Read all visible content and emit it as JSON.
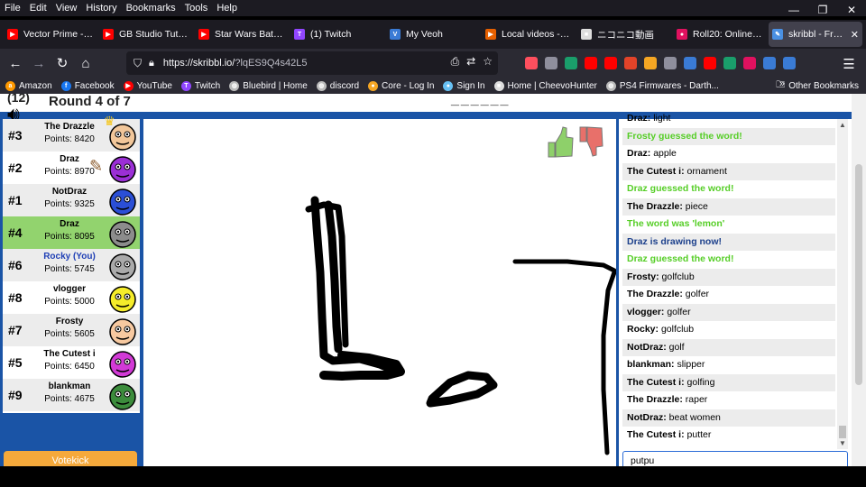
{
  "menubar": [
    "File",
    "Edit",
    "View",
    "History",
    "Bookmarks",
    "Tools",
    "Help"
  ],
  "window_controls": [
    "—",
    "❐",
    "✕"
  ],
  "tabs": [
    {
      "title": "Vector Prime - Pa",
      "icon": "youtube-icon",
      "color": "#ff0000",
      "glyph": "▶"
    },
    {
      "title": "GB Studio Tutorial",
      "icon": "youtube-icon",
      "color": "#ff0000",
      "glyph": "▶"
    },
    {
      "title": "Star Wars Battlefro",
      "icon": "youtube-icon",
      "color": "#ff0000",
      "glyph": "▶"
    },
    {
      "title": "(1) Twitch",
      "icon": "twitch-icon",
      "color": "#9146ff",
      "glyph": "T"
    },
    {
      "title": "My Veoh",
      "icon": "veoh-icon",
      "color": "#3a7bd5",
      "glyph": "V"
    },
    {
      "title": "Local videos - Ha",
      "icon": "play-icon",
      "color": "#e66000",
      "glyph": "▶"
    },
    {
      "title": "ニコニコ動画",
      "icon": "niconico-icon",
      "color": "#dddddd",
      "glyph": "■"
    },
    {
      "title": "Roll20: Online virt",
      "icon": "roll20-icon",
      "color": "#e0115f",
      "glyph": "●"
    },
    {
      "title": "skribbl - Free M",
      "icon": "skribbl-icon",
      "color": "#4a90e2",
      "glyph": "✎",
      "active": true
    }
  ],
  "nav": {
    "back": "←",
    "forward": "→",
    "reload": "↻",
    "home": "⌂",
    "url_host": "https://skribbl.io/",
    "url_path": "?lqES9Q4s42L5"
  },
  "extension_colors": [
    "#ff4f5e",
    "#8f8f9d",
    "#1a9e6b",
    "#ff0000",
    "#ff0000",
    "#e24329",
    "#f5a623",
    "#8f8f9d",
    "#3a7bd5",
    "#ff0000",
    "#1a9e6b",
    "#e0115f",
    "#3a7bd5",
    "#3a7bd5"
  ],
  "bookmarks": [
    {
      "label": "Amazon",
      "icon": "amazon-icon",
      "color": "#ff9900",
      "glyph": "a"
    },
    {
      "label": "Facebook",
      "icon": "facebook-icon",
      "color": "#1877f2",
      "glyph": "f"
    },
    {
      "label": "YouTube",
      "icon": "youtube-icon",
      "color": "#ff0000",
      "glyph": "▶"
    },
    {
      "label": "Twitch",
      "icon": "twitch-icon",
      "color": "#9146ff",
      "glyph": "T"
    },
    {
      "label": "Bluebird | Home",
      "icon": "globe-icon",
      "color": "#bbbbbb",
      "glyph": "◍"
    },
    {
      "label": "discord",
      "icon": "globe-icon",
      "color": "#bbbbbb",
      "glyph": "◍"
    },
    {
      "label": "Core - Log In",
      "icon": "core-icon",
      "color": "#f5a623",
      "glyph": "●"
    },
    {
      "label": "Sign In",
      "icon": "steam-icon",
      "color": "#66c0f4",
      "glyph": "●"
    },
    {
      "label": "Home | CheevoHunter",
      "icon": "page-icon",
      "color": "#dddddd",
      "glyph": "■"
    },
    {
      "label": "PS4 Firmwares - Darth...",
      "icon": "globe-icon",
      "color": "#bbbbbb",
      "glyph": "◍"
    }
  ],
  "other_bookmarks": "Other Bookmarks",
  "game": {
    "round_label": "Round 4 of 7",
    "timer": "(12)",
    "word_hint": "______",
    "votekick": "Votekick",
    "chat_input_value": "putpu",
    "players": [
      {
        "rank": "#3",
        "name": "The Drazzle",
        "points": "Points: 8420",
        "avatar_color": "#f2c79a",
        "crown": true,
        "style": "alt"
      },
      {
        "rank": "#2",
        "name": "Draz",
        "points": "Points: 8970",
        "avatar_color": "#9b2fd6",
        "pencil": true,
        "style": ""
      },
      {
        "rank": "#1",
        "name": "NotDraz",
        "points": "Points: 9325",
        "avatar_color": "#2b4fd6",
        "style": "alt"
      },
      {
        "rank": "#4",
        "name": "Draz",
        "points": "Points: 8095",
        "avatar_color": "#8c8c8c",
        "style": "drawer"
      },
      {
        "rank": "#6",
        "name": "Rocky (You)",
        "points": "Points: 5745",
        "avatar_color": "#aaaaaa",
        "you": true,
        "style": "alt"
      },
      {
        "rank": "#8",
        "name": "vlogger",
        "points": "Points: 5000",
        "avatar_color": "#f5ec2a",
        "style": ""
      },
      {
        "rank": "#7",
        "name": "Frosty",
        "points": "Points: 5605",
        "avatar_color": "#f7c9a0",
        "style": "alt"
      },
      {
        "rank": "#5",
        "name": "The Cutest i",
        "points": "Points: 6450",
        "avatar_color": "#d23ad6",
        "style": ""
      },
      {
        "rank": "#9",
        "name": "blankman",
        "points": "Points: 4675",
        "avatar_color": "#3c8c3c",
        "style": "alt"
      }
    ],
    "chat": [
      {
        "who": "Draz:",
        "text": "light",
        "type": "msg"
      },
      {
        "text": "Frosty guessed the word!",
        "type": "green"
      },
      {
        "who": "Draz:",
        "text": "apple",
        "type": "msg"
      },
      {
        "who": "The Cutest i:",
        "text": "ornament",
        "type": "msg"
      },
      {
        "text": "Draz guessed the word!",
        "type": "green"
      },
      {
        "who": "The Drazzle:",
        "text": "piece",
        "type": "msg"
      },
      {
        "text": "The word was 'lemon'",
        "type": "green"
      },
      {
        "text": "Draz is drawing now!",
        "type": "blue"
      },
      {
        "text": "Draz guessed the word!",
        "type": "green"
      },
      {
        "who": "Frosty:",
        "text": "golfclub",
        "type": "msg"
      },
      {
        "who": "The Drazzle:",
        "text": "golfer",
        "type": "msg"
      },
      {
        "who": "vlogger:",
        "text": "golfer",
        "type": "msg"
      },
      {
        "who": "Rocky:",
        "text": "golfclub",
        "type": "msg"
      },
      {
        "who": "NotDraz:",
        "text": "golf",
        "type": "msg"
      },
      {
        "who": "blankman:",
        "text": "slipper",
        "type": "msg"
      },
      {
        "who": "The Cutest i:",
        "text": "golfing",
        "type": "msg"
      },
      {
        "who": "The Drazzle:",
        "text": "raper",
        "type": "msg"
      },
      {
        "who": "NotDraz:",
        "text": "beat women",
        "type": "msg"
      },
      {
        "who": "The Cutest i:",
        "text": "putter",
        "type": "msg"
      }
    ]
  }
}
